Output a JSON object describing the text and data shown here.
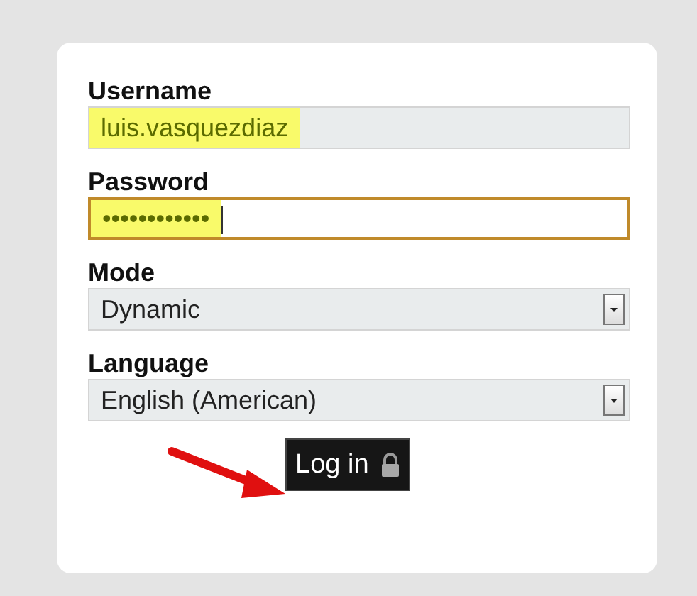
{
  "login_form": {
    "fields": [
      {
        "kind": "text",
        "label": "Username",
        "value": "luis.vasquezdiaz",
        "focused": false,
        "highlighted": true
      },
      {
        "kind": "password",
        "label": "Password",
        "value": "••••••••••••",
        "focused": true,
        "highlighted": true
      },
      {
        "kind": "select",
        "label": "Mode",
        "value": "Dynamic",
        "focused": false,
        "highlighted": false
      },
      {
        "kind": "select",
        "label": "Language",
        "value": "English (American)",
        "focused": false,
        "highlighted": false
      }
    ],
    "login_button": {
      "label": "Log in"
    }
  },
  "annotation": {
    "arrow": true
  }
}
